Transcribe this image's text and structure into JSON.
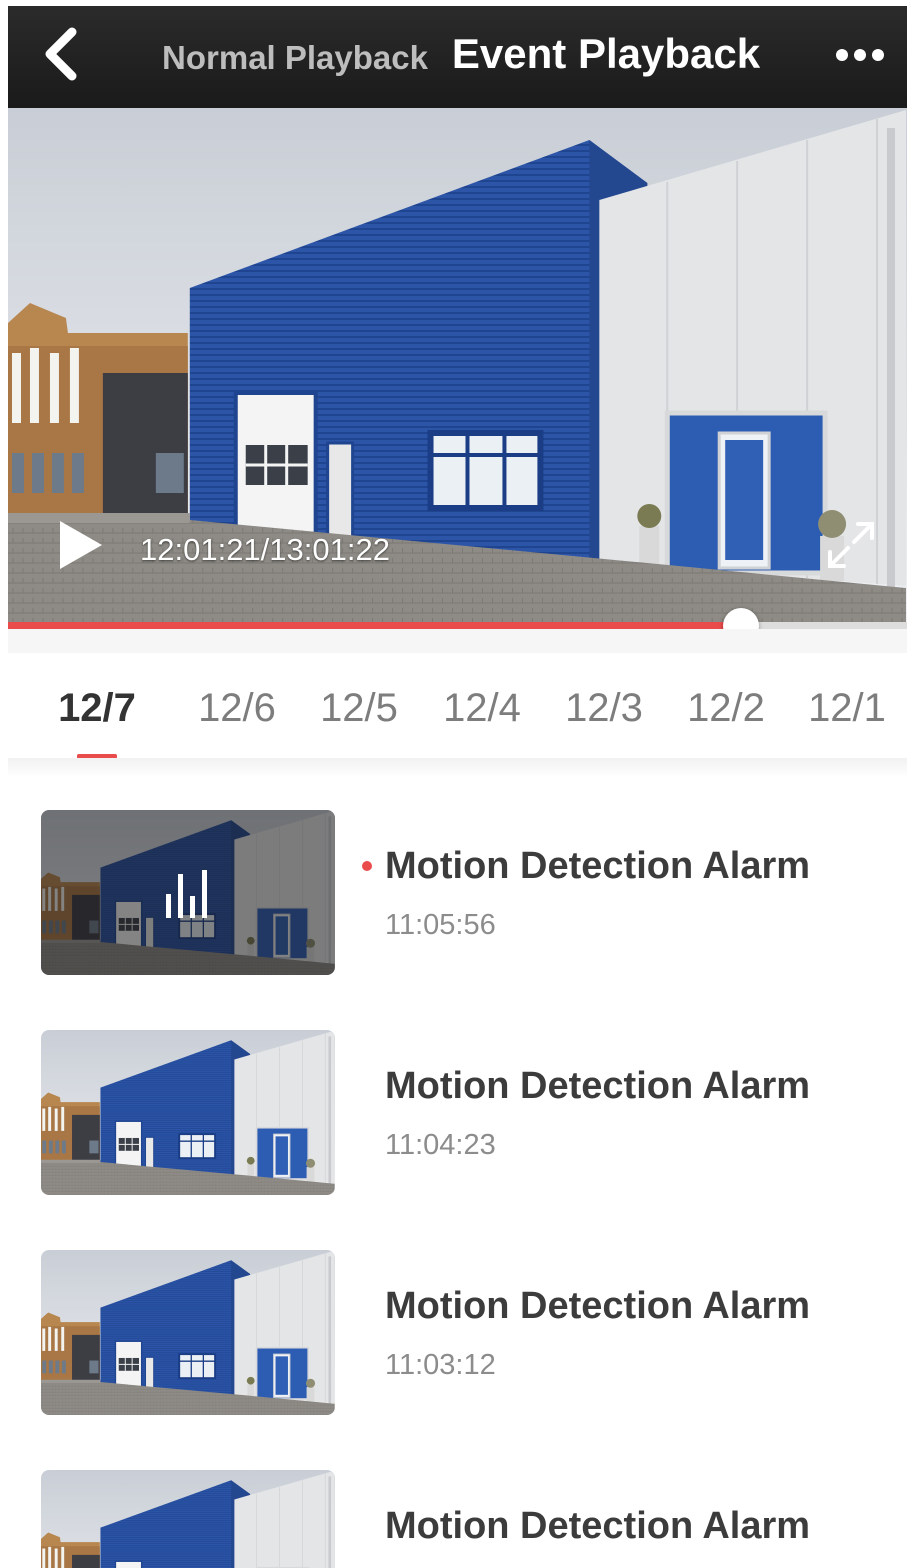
{
  "header": {
    "tab_normal": "Normal Playback",
    "tab_event": "Event Playback",
    "back_icon": "back-chevron-icon",
    "more_icon": "more-dots-icon"
  },
  "player": {
    "time_readout": "12:01:21/13:01:22",
    "progress": 0.815,
    "accent_color": "#ea4b4b"
  },
  "date_tabs": [
    {
      "label": "12/7",
      "active": true
    },
    {
      "label": "12/6",
      "active": false
    },
    {
      "label": "12/5",
      "active": false
    },
    {
      "label": "12/4",
      "active": false
    },
    {
      "label": "12/3",
      "active": false
    },
    {
      "label": "12/2",
      "active": false
    },
    {
      "label": "12/1",
      "active": false
    }
  ],
  "events": [
    {
      "title": "Motion Detection Alarm",
      "time": "11:05:56",
      "unread": true,
      "playing": true
    },
    {
      "title": "Motion Detection Alarm",
      "time": "11:04:23",
      "unread": false,
      "playing": false
    },
    {
      "title": "Motion Detection Alarm",
      "time": "11:03:12",
      "unread": false,
      "playing": false
    },
    {
      "title": "Motion Detection Alarm",
      "time": "",
      "unread": false,
      "playing": false
    }
  ]
}
